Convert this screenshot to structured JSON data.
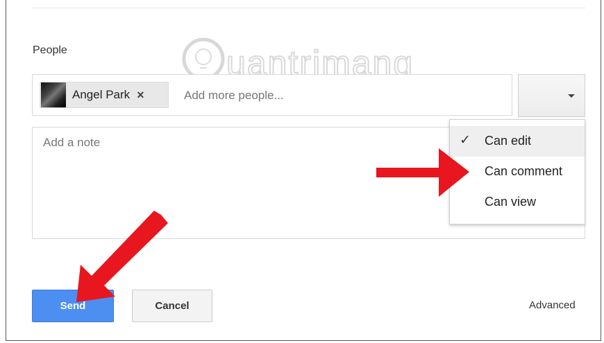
{
  "dialog": {
    "people_label": "People",
    "chip": {
      "name": "Angel Park",
      "remove_icon": "×"
    },
    "add_people_placeholder": "Add more people...",
    "note_placeholder": "Add a note",
    "permission_menu": {
      "items": [
        {
          "label": "Can edit",
          "checked": true,
          "check_icon": "✓"
        },
        {
          "label": "Can comment",
          "checked": false
        },
        {
          "label": "Can view",
          "checked": false
        }
      ]
    },
    "send_label": "Send",
    "cancel_label": "Cancel",
    "advanced_label": "Advanced"
  },
  "watermark": {
    "text": "uantrimang"
  },
  "colors": {
    "send_button": "#4d8ff0",
    "annotation_arrow": "#e8161e"
  }
}
